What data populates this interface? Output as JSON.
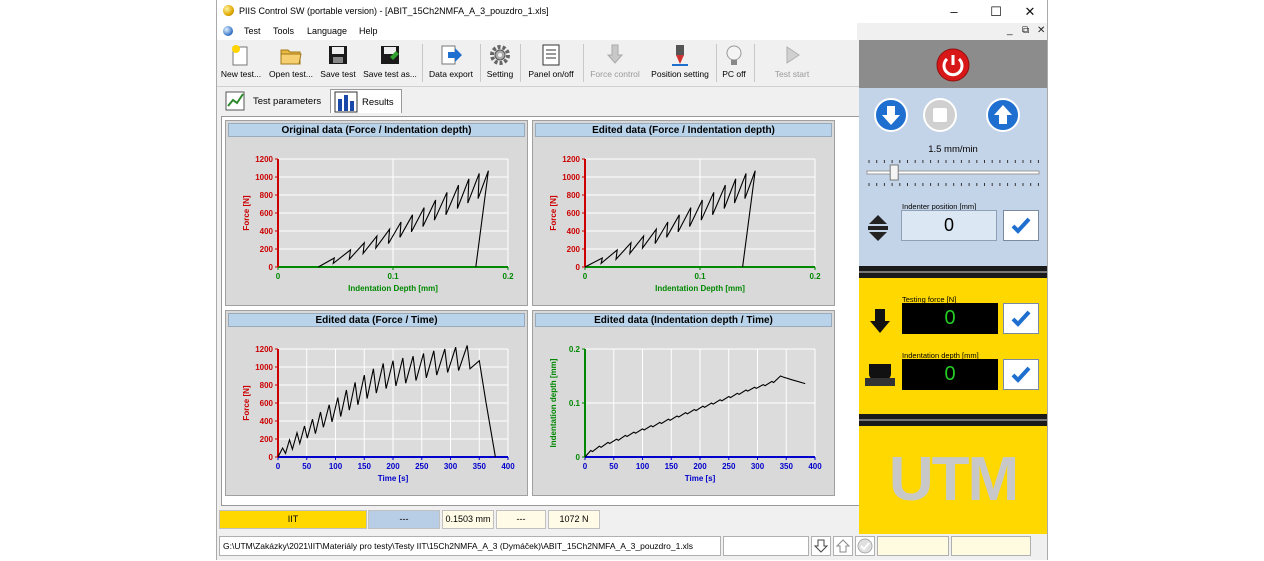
{
  "window": {
    "title": "PIIS Control SW (portable version) - [ABIT_15Ch2NMFA_A_3_pouzdro_1.xls]",
    "controls": [
      "–",
      "☐",
      "✕"
    ]
  },
  "menu": {
    "items": [
      "Test",
      "Tools",
      "Language",
      "Help"
    ],
    "mdi_controls": [
      "_",
      "⧉",
      "✕"
    ]
  },
  "toolbar": {
    "buttons": [
      {
        "label": "New test...",
        "icon": "new-file-icon",
        "enabled": true
      },
      {
        "label": "Open test...",
        "icon": "open-folder-icon",
        "enabled": true
      },
      {
        "label": "Save test",
        "icon": "save-disk-icon",
        "enabled": true
      },
      {
        "label": "Save test as...",
        "icon": "save-as-disk-icon",
        "enabled": true
      },
      {
        "label": "Data export",
        "icon": "export-arrow-icon",
        "enabled": true
      },
      {
        "label": "Setting",
        "icon": "gear-icon",
        "enabled": true
      },
      {
        "label": "Panel on/off",
        "icon": "panel-icon",
        "enabled": true
      },
      {
        "label": "Force control",
        "icon": "force-control-icon",
        "enabled": false
      },
      {
        "label": "Position setting",
        "icon": "position-setting-icon",
        "enabled": true
      },
      {
        "label": "PC off",
        "icon": "light-bulb-icon",
        "enabled": true
      },
      {
        "label": "Test start",
        "icon": "play-icon",
        "enabled": false
      }
    ]
  },
  "tabs": [
    {
      "label": "Test parameters",
      "icon": "test-parameters-icon",
      "active": false
    },
    {
      "label": "Results",
      "icon": "results-chart-icon",
      "active": true
    }
  ],
  "status": {
    "method": "IIT",
    "slot2": "---",
    "depth": "0.1503 mm",
    "slot4": "---",
    "force": "1072 N"
  },
  "pathbar": {
    "path": "G:\\UTM\\Zakázky\\2021\\IIT\\Materiály pro testy\\Testy IIT\\15Ch2NMFA_A_3 (Dymáček)\\ABIT_15Ch2NMFA_A_3_pouzdro_1.xls"
  },
  "control_panel": {
    "speed": "1.5 mm/min",
    "speed_level": 0.15,
    "indenter_position_label": "Indenter position [mm]",
    "indenter_position_value": "0",
    "testing_force_label": "Testing force [N]",
    "testing_force_value": "0",
    "indentation_depth_label": "Indentation depth [mm]",
    "indentation_depth_value": "0",
    "logo_text": "UTM"
  },
  "colors": {
    "yellow": "#ffd800",
    "panel_blue": "#c4d4e8",
    "header_blue": "#b8d3ea",
    "force_axis": "#cc0000",
    "depth_axis": "#008800",
    "time_axis": "#0000cc"
  },
  "chart_data": [
    {
      "type": "line",
      "title": "Original data (Force / Indentation depth)",
      "xlabel": "Indentation Depth [mm]",
      "ylabel": "Force [N]",
      "xlim": [
        0,
        0.2
      ],
      "ylim": [
        0,
        1200
      ],
      "xticks": [
        "0",
        "0.1",
        "0.2"
      ],
      "yticks": [
        "0",
        "200",
        "400",
        "600",
        "800",
        "1000",
        "1200"
      ],
      "grid": true,
      "x_axis_color": "#008800",
      "y_axis_color": "#cc0000",
      "cycles": [
        {
          "load_start_x": 0.035,
          "peak_x": 0.049,
          "peak_y": 100,
          "unload_x": 0.048,
          "unload_y": 40
        },
        {
          "peak_x": 0.063,
          "peak_y": 190,
          "unload_x": 0.062,
          "unload_y": 85
        },
        {
          "peak_x": 0.075,
          "peak_y": 270,
          "unload_x": 0.074,
          "unload_y": 150
        },
        {
          "peak_x": 0.086,
          "peak_y": 345,
          "unload_x": 0.085,
          "unload_y": 210
        },
        {
          "peak_x": 0.097,
          "peak_y": 420,
          "unload_x": 0.096,
          "unload_y": 260
        },
        {
          "peak_x": 0.107,
          "peak_y": 500,
          "unload_x": 0.106,
          "unload_y": 330
        },
        {
          "peak_x": 0.117,
          "peak_y": 580,
          "unload_x": 0.116,
          "unload_y": 390
        },
        {
          "peak_x": 0.127,
          "peak_y": 660,
          "unload_x": 0.126,
          "unload_y": 450
        },
        {
          "peak_x": 0.137,
          "peak_y": 745,
          "unload_x": 0.136,
          "unload_y": 520
        },
        {
          "peak_x": 0.147,
          "peak_y": 830,
          "unload_x": 0.146,
          "unload_y": 580
        },
        {
          "peak_x": 0.157,
          "peak_y": 910,
          "unload_x": 0.156,
          "unload_y": 650
        },
        {
          "peak_x": 0.166,
          "peak_y": 980,
          "unload_x": 0.165,
          "unload_y": 710
        },
        {
          "peak_x": 0.175,
          "peak_y": 1040,
          "unload_x": 0.174,
          "unload_y": 760
        },
        {
          "peak_x": 0.183,
          "peak_y": 1070,
          "unload_x": 0.172,
          "unload_y": 0
        }
      ]
    },
    {
      "type": "line",
      "title": "Edited data (Force / Indentation depth)",
      "xlabel": "Indentation Depth [mm]",
      "ylabel": "Force [N]",
      "xlim": [
        0,
        0.2
      ],
      "ylim": [
        0,
        1200
      ],
      "xticks": [
        "0",
        "0.1",
        "0.2"
      ],
      "yticks": [
        "0",
        "200",
        "400",
        "600",
        "800",
        "1000",
        "1200"
      ],
      "grid": true,
      "x_axis_color": "#008800",
      "y_axis_color": "#cc0000",
      "cycles": [
        {
          "load_start_x": 0.0,
          "peak_x": 0.015,
          "peak_y": 100,
          "unload_x": 0.014,
          "unload_y": 40
        },
        {
          "peak_x": 0.028,
          "peak_y": 190,
          "unload_x": 0.027,
          "unload_y": 85
        },
        {
          "peak_x": 0.04,
          "peak_y": 270,
          "unload_x": 0.039,
          "unload_y": 150
        },
        {
          "peak_x": 0.051,
          "peak_y": 345,
          "unload_x": 0.05,
          "unload_y": 210
        },
        {
          "peak_x": 0.062,
          "peak_y": 420,
          "unload_x": 0.061,
          "unload_y": 260
        },
        {
          "peak_x": 0.072,
          "peak_y": 500,
          "unload_x": 0.071,
          "unload_y": 330
        },
        {
          "peak_x": 0.082,
          "peak_y": 580,
          "unload_x": 0.081,
          "unload_y": 390
        },
        {
          "peak_x": 0.092,
          "peak_y": 660,
          "unload_x": 0.091,
          "unload_y": 450
        },
        {
          "peak_x": 0.102,
          "peak_y": 745,
          "unload_x": 0.101,
          "unload_y": 520
        },
        {
          "peak_x": 0.112,
          "peak_y": 830,
          "unload_x": 0.111,
          "unload_y": 580
        },
        {
          "peak_x": 0.122,
          "peak_y": 910,
          "unload_x": 0.121,
          "unload_y": 650
        },
        {
          "peak_x": 0.131,
          "peak_y": 980,
          "unload_x": 0.13,
          "unload_y": 710
        },
        {
          "peak_x": 0.14,
          "peak_y": 1040,
          "unload_x": 0.139,
          "unload_y": 760
        },
        {
          "peak_x": 0.148,
          "peak_y": 1070,
          "unload_x": 0.137,
          "unload_y": 0
        }
      ]
    },
    {
      "type": "line",
      "title": "Edited data (Force / Time)",
      "xlabel": "Time [s]",
      "ylabel": "Force [N]",
      "xlim": [
        0,
        400
      ],
      "ylim": [
        0,
        1200
      ],
      "xticks": [
        "0",
        "50",
        "100",
        "150",
        "200",
        "250",
        "300",
        "350",
        "400"
      ],
      "yticks": [
        "0",
        "200",
        "400",
        "600",
        "800",
        "1000",
        "1200"
      ],
      "grid": true,
      "x_axis_color": "#0000cc",
      "y_axis_color": "#cc0000",
      "x": [
        0,
        8,
        13,
        20,
        25,
        33,
        38,
        46,
        51,
        60,
        65,
        74,
        79,
        89,
        94,
        104,
        109,
        119,
        124,
        134,
        139,
        150,
        155,
        166,
        171,
        183,
        188,
        200,
        205,
        217,
        222,
        235,
        240,
        253,
        258,
        271,
        276,
        290,
        295,
        309,
        314,
        329,
        334,
        350,
        362,
        378
      ],
      "y": [
        0,
        100,
        40,
        190,
        85,
        270,
        150,
        345,
        210,
        420,
        260,
        500,
        330,
        580,
        390,
        660,
        450,
        745,
        520,
        830,
        580,
        910,
        650,
        980,
        710,
        1040,
        760,
        1070,
        790,
        1100,
        820,
        1120,
        850,
        1150,
        880,
        1180,
        910,
        1200,
        940,
        1220,
        960,
        1240,
        980,
        1070,
        600,
        0
      ]
    },
    {
      "type": "line",
      "title": "Edited data (Indentation depth / Time)",
      "xlabel": "Time [s]",
      "ylabel": "Indentation depth [mm]",
      "xlim": [
        0,
        400
      ],
      "ylim": [
        0,
        0.2
      ],
      "xticks": [
        "0",
        "50",
        "100",
        "150",
        "200",
        "250",
        "300",
        "350",
        "400"
      ],
      "yticks": [
        "0",
        "0.1",
        "0.2"
      ],
      "grid": true,
      "x_axis_color": "#0000cc",
      "y_axis_color": "#008800",
      "x": [
        0,
        10,
        13,
        25,
        28,
        40,
        43,
        55,
        58,
        70,
        73,
        85,
        88,
        100,
        103,
        115,
        118,
        130,
        133,
        145,
        148,
        160,
        163,
        175,
        178,
        190,
        193,
        205,
        208,
        220,
        223,
        235,
        238,
        250,
        253,
        265,
        268,
        280,
        283,
        295,
        298,
        310,
        313,
        325,
        328,
        340,
        345,
        360,
        383
      ],
      "y": [
        0,
        0.012,
        0.01,
        0.02,
        0.018,
        0.027,
        0.025,
        0.033,
        0.031,
        0.04,
        0.038,
        0.046,
        0.044,
        0.052,
        0.05,
        0.058,
        0.056,
        0.064,
        0.062,
        0.07,
        0.068,
        0.076,
        0.074,
        0.082,
        0.08,
        0.088,
        0.086,
        0.094,
        0.092,
        0.1,
        0.098,
        0.106,
        0.104,
        0.112,
        0.11,
        0.118,
        0.116,
        0.124,
        0.122,
        0.129,
        0.127,
        0.134,
        0.132,
        0.14,
        0.138,
        0.15,
        0.148,
        0.143,
        0.136
      ]
    }
  ]
}
